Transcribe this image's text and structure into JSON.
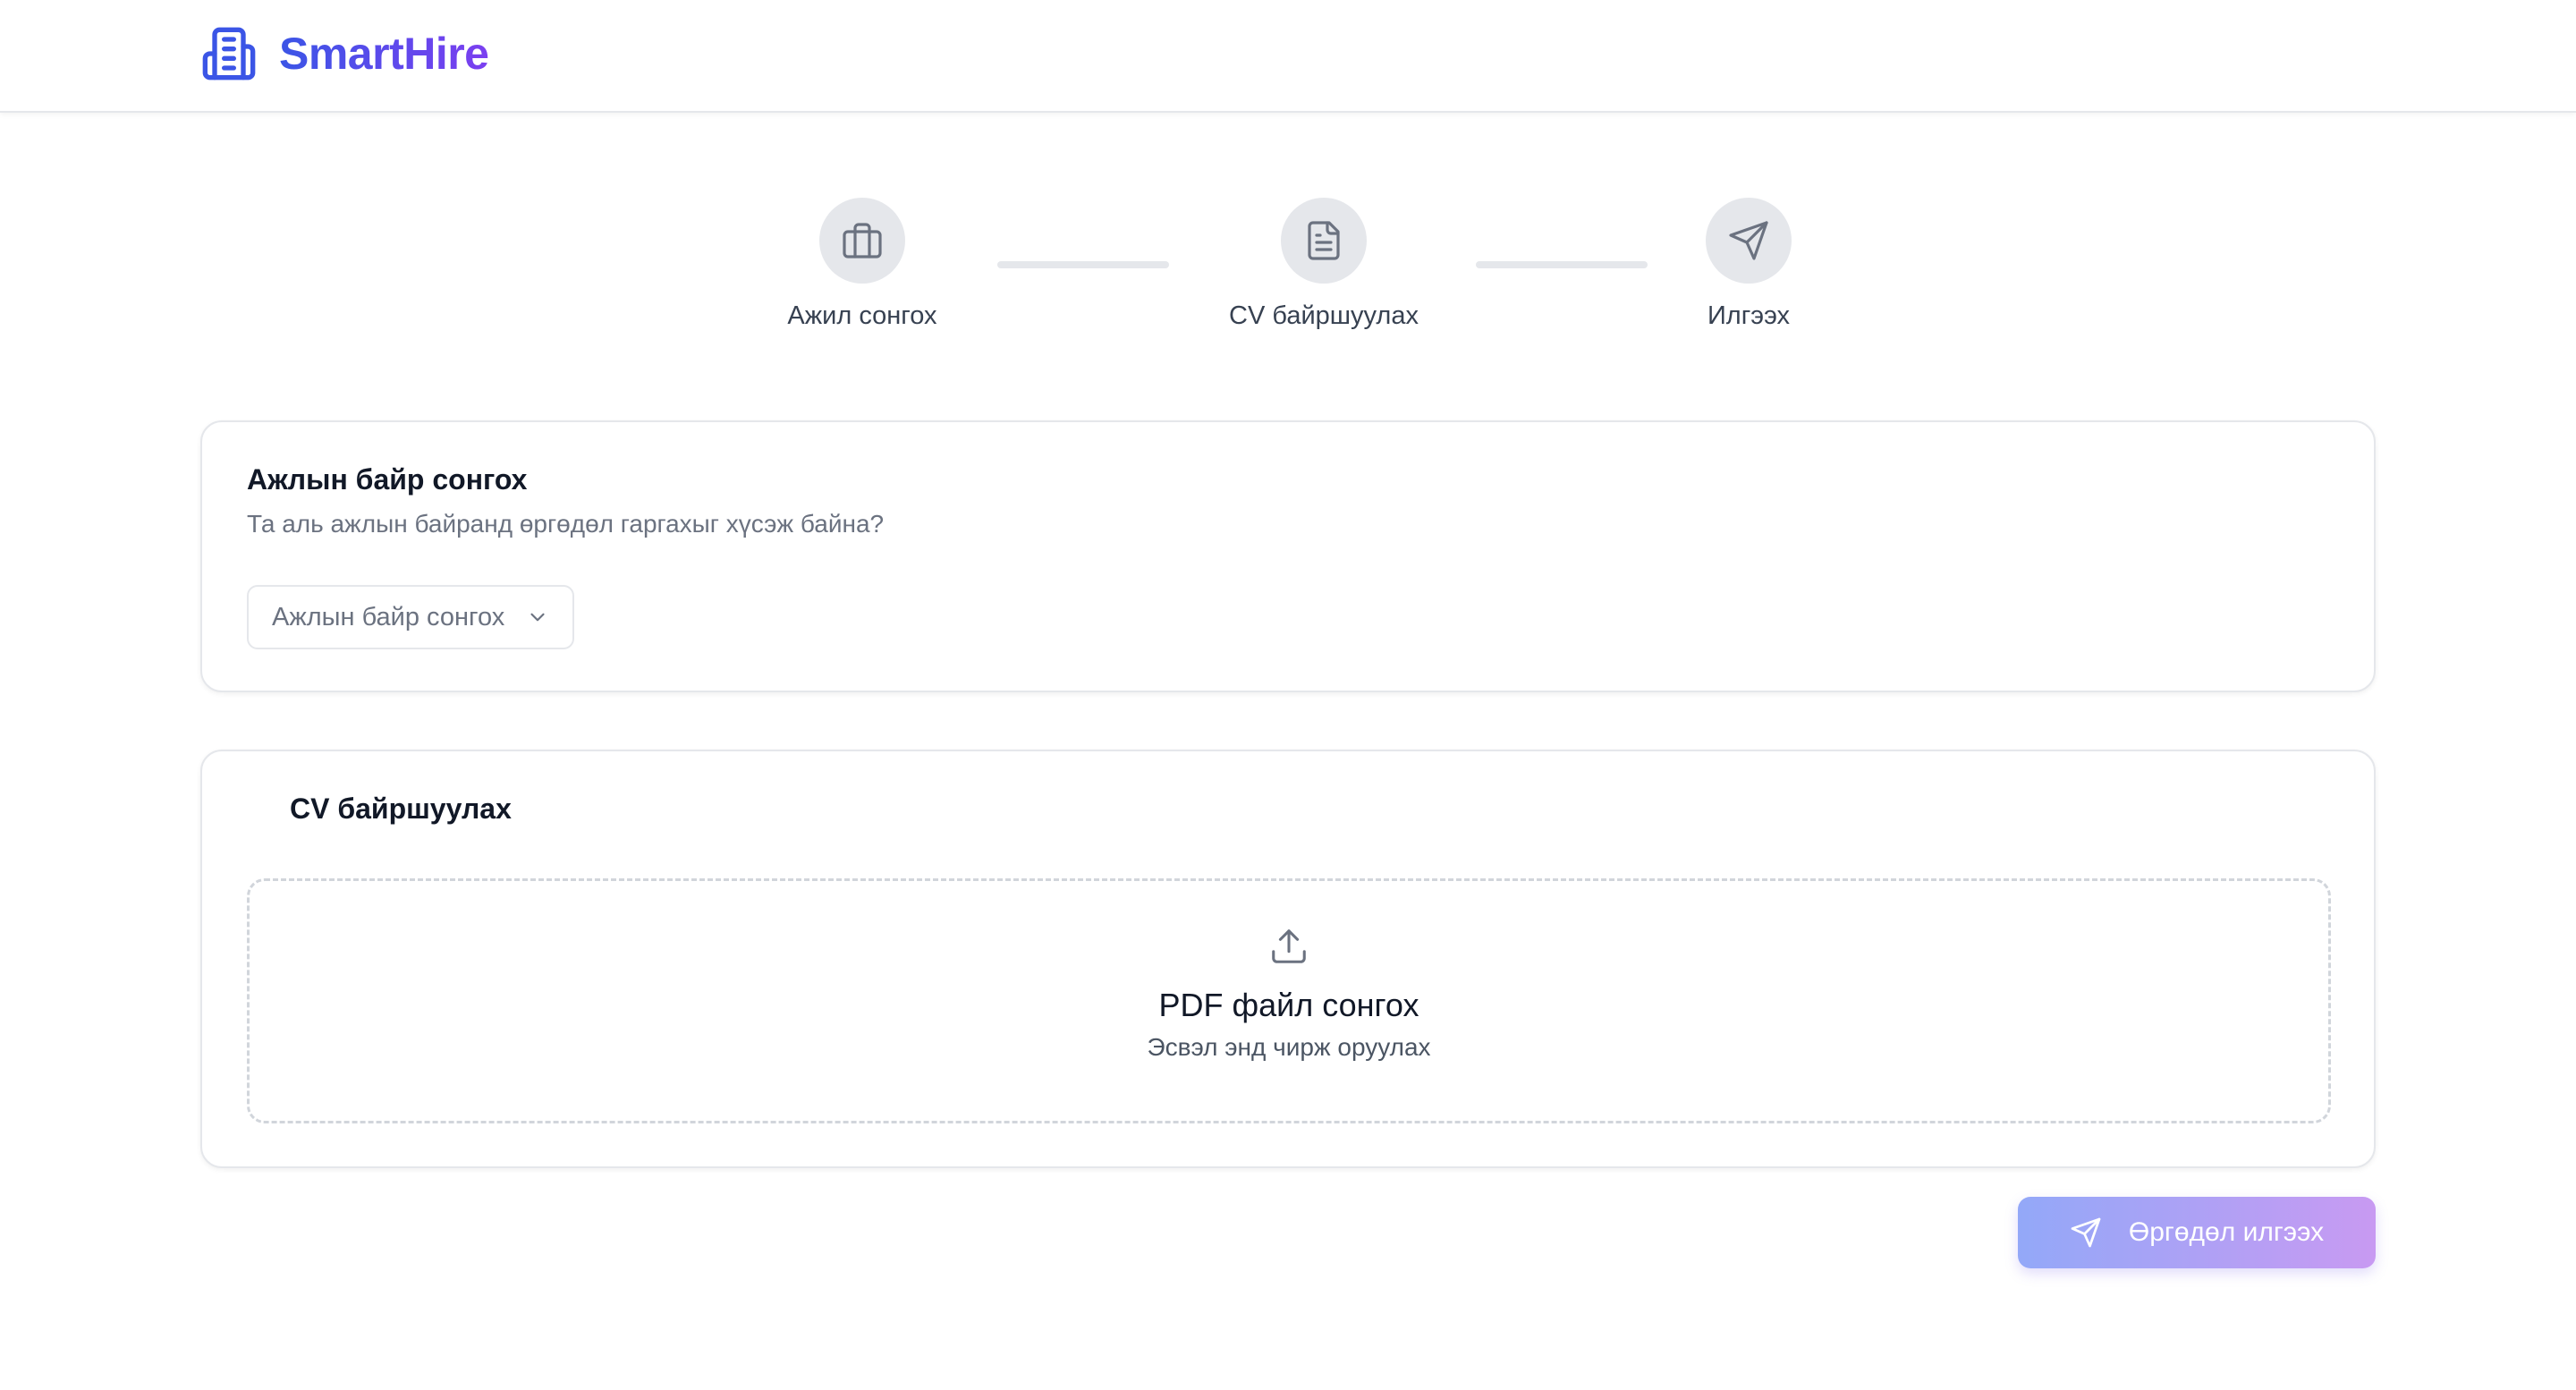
{
  "app": {
    "name": "SmartHire",
    "logo_icon": "building-icon",
    "brand_color_start": "#3b55e6",
    "brand_color_end": "#7b3ff0"
  },
  "stepper": {
    "steps": [
      {
        "label": "Ажил сонгох",
        "icon": "briefcase-icon"
      },
      {
        "label": "CV байршуулах",
        "icon": "file-text-icon"
      },
      {
        "label": "Илгээх",
        "icon": "send-icon"
      }
    ]
  },
  "job_card": {
    "title": "Ажлын байр сонгох",
    "subtitle": "Та аль ажлын байранд өргөдөл гаргахыг хүсэж байна?",
    "select_placeholder": "Ажлын байр сонгох"
  },
  "cv_card": {
    "title": "CV байршуулах",
    "dropzone_title": "PDF файл сонгох",
    "dropzone_subtitle": "Эсвэл энд чирж оруулах"
  },
  "submit": {
    "label": "Өргөдөл илгээх",
    "icon": "send-icon",
    "disabled": true
  }
}
